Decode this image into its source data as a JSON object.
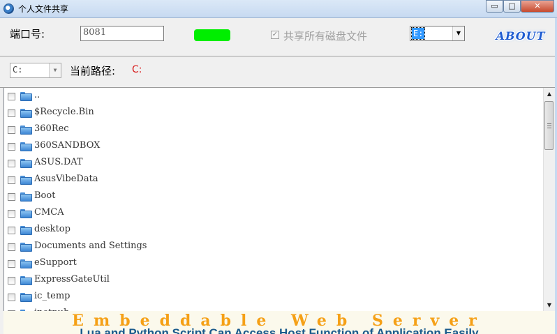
{
  "window": {
    "title": "个人文件共享",
    "minimize_label": "▭",
    "maximize_label": "□",
    "close_label": "✕"
  },
  "top_panel": {
    "port_label": "端口号:",
    "port_value": "8081",
    "status_color": "#00ee00",
    "share_all_label": "共享所有磁盘文件",
    "share_all_checked": true,
    "drive_selected": "E:",
    "about_label": "ABOUT"
  },
  "path_panel": {
    "drive_value": "C:",
    "path_label": "当前路径:",
    "path_value": "C:"
  },
  "files": [
    {
      "name": ".."
    },
    {
      "name": "$Recycle.Bin"
    },
    {
      "name": "360Rec"
    },
    {
      "name": "360SANDBOX"
    },
    {
      "name": "ASUS.DAT"
    },
    {
      "name": "AsusVibeData"
    },
    {
      "name": "Boot"
    },
    {
      "name": "CMCA"
    },
    {
      "name": "desktop"
    },
    {
      "name": "Documents and Settings"
    },
    {
      "name": "eSupport"
    },
    {
      "name": "ExpressGateUtil"
    },
    {
      "name": "ic_temp"
    },
    {
      "name": "inetpub"
    }
  ],
  "banner": {
    "title": "Embeddable Web Server",
    "subtitle": "Lua and Python Script Can Access Host Function of Application Easily"
  },
  "icons": {
    "app": "app-globe-icon",
    "folder": "folder-icon",
    "dropdown": "chevron-down-icon"
  }
}
